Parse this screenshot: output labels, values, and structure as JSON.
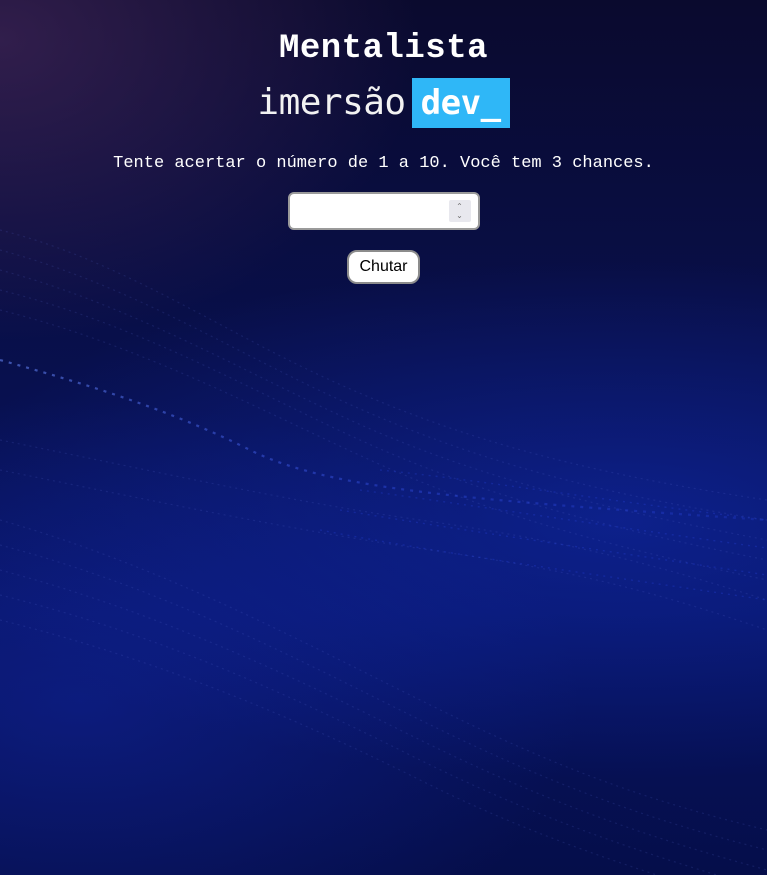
{
  "app": {
    "title": "Mentalista",
    "logo": {
      "word": "imersão",
      "highlight": "dev_",
      "highlight_color": "#2fb7f7"
    }
  },
  "main": {
    "instructions": "Tente acertar o número de 1 a 10. Você tem 3 chances.",
    "guess_input": {
      "value": "",
      "placeholder": "",
      "type": "number"
    },
    "guess_button_label": "Chutar"
  },
  "icons": {
    "spinner_up": "chevron-up-icon",
    "spinner_down": "chevron-down-icon"
  },
  "colors": {
    "background_dark": "#0a0a2e",
    "background_blue": "#071360",
    "text": "#ffffff"
  }
}
